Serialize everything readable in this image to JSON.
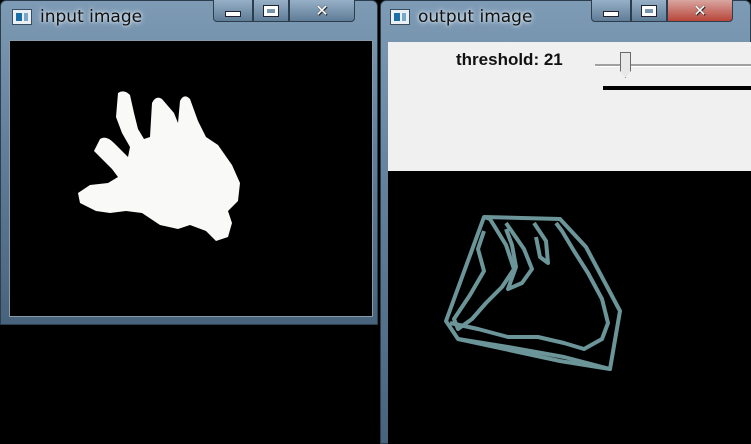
{
  "windows": {
    "input": {
      "title": "input image",
      "icon": "opencv-window-icon"
    },
    "output": {
      "title": "output image",
      "icon": "opencv-window-icon",
      "trackbar": {
        "label": "threshold: 21",
        "value": 21
      }
    }
  },
  "window_controls": {
    "minimize": "minimize-icon",
    "maximize": "maximize-icon",
    "close": "close-icon"
  },
  "colors": {
    "blob": "#f9f9f7",
    "contour": "#6b9598",
    "canvas": "#000000",
    "panel": "#f0f0f0"
  }
}
